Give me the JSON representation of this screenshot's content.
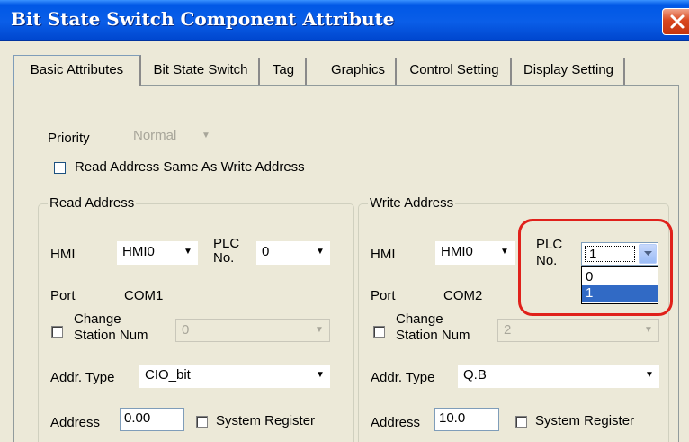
{
  "window": {
    "title": "Bit State Switch Component Attribute"
  },
  "tabs": [
    {
      "label": "Basic Attributes",
      "active": true
    },
    {
      "label": "Bit State Switch",
      "active": false
    },
    {
      "label": "Tag",
      "active": false
    },
    {
      "label": "Graphics",
      "active": false
    },
    {
      "label": "Control Setting",
      "active": false
    },
    {
      "label": "Display Setting",
      "active": false
    }
  ],
  "basic": {
    "priority_label": "Priority",
    "priority_value": "Normal",
    "read_same_as_write_label": "Read Address Same As Write Address",
    "read_same_as_write_checked": false
  },
  "read_address": {
    "title": "Read Address",
    "hmi_label": "HMI",
    "hmi_value": "HMI0",
    "plc_label_1": "PLC",
    "plc_label_2": "No.",
    "plc_value": "0",
    "port_label": "Port",
    "port_value": "COM1",
    "change_station_1": "Change",
    "change_station_2": "Station Num",
    "station_value": "0",
    "addr_type_label": "Addr. Type",
    "addr_type_value": "CIO_bit",
    "address_label": "Address",
    "address_value": "0.00",
    "system_register_label": "System Register"
  },
  "write_address": {
    "title": "Write Address",
    "hmi_label": "HMI",
    "hmi_value": "HMI0",
    "plc_label_1": "PLC",
    "plc_label_2": "No.",
    "plc_value": "1",
    "plc_options": [
      "0",
      "1"
    ],
    "plc_selected_index": 1,
    "port_label": "Port",
    "port_value": "COM2",
    "change_station_1": "Change",
    "change_station_2": "Station Num",
    "station_value": "2",
    "addr_type_label": "Addr. Type",
    "addr_type_value": "Q.B",
    "address_label": "Address",
    "address_value": "10.0",
    "system_register_label": "System Register"
  },
  "colors": {
    "titlebar": "#0a5ee8",
    "highlight": "#e0211b",
    "selection": "#316ac5"
  }
}
